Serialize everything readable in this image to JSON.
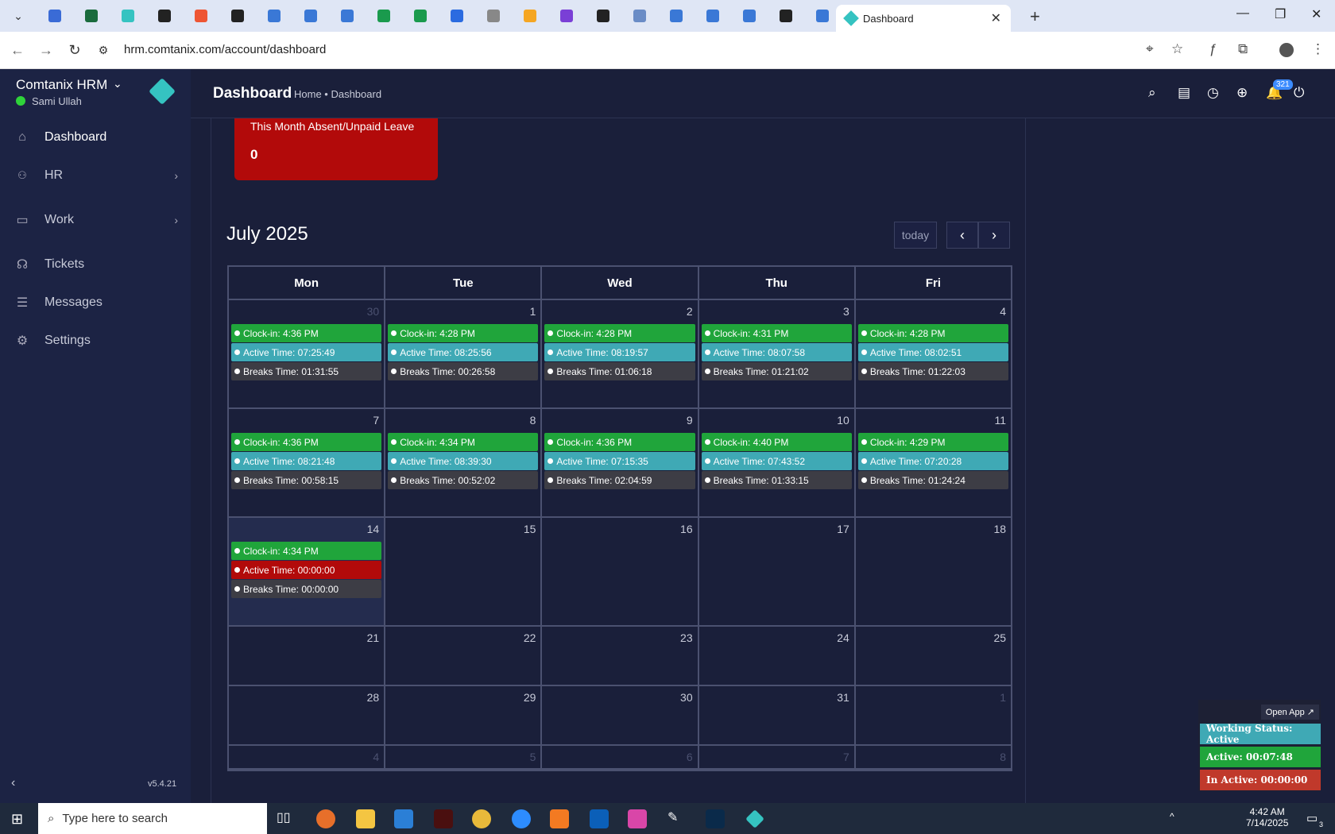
{
  "browser": {
    "active_tab_title": "Dashboard",
    "url": "hrm.comtanix.com/account/dashboard",
    "tab_icon_colors": [
      "#3a6bd6",
      "#1a6b3d",
      "#35c3c1",
      "#222",
      "#e53",
      "#222",
      "#3a78d6",
      "#3a78d6",
      "#3a78d6",
      "#1a9a4d",
      "#1a9a4d",
      "#2b6be0",
      "#888",
      "#f5a623",
      "#7a3fd6",
      "#222",
      "#6a8cc6",
      "#3a78d6",
      "#3a78d6",
      "#3a78d6",
      "#222",
      "#3a78d6"
    ]
  },
  "sidebar": {
    "brand": "Comtanix HRM",
    "user": "Sami Ullah",
    "items": [
      {
        "label": "Dashboard",
        "icon": "home-icon",
        "glyph": "⌂"
      },
      {
        "label": "HR",
        "icon": "users-icon",
        "glyph": "👥"
      },
      {
        "label": "Work",
        "icon": "briefcase-icon",
        "glyph": "▭"
      },
      {
        "label": "Tickets",
        "icon": "headset-icon",
        "glyph": "☊"
      },
      {
        "label": "Messages",
        "icon": "message-icon",
        "glyph": "☰"
      },
      {
        "label": "Settings",
        "icon": "gear-icon",
        "glyph": "⚙"
      }
    ],
    "version": "v5.4.21"
  },
  "header": {
    "title": "Dashboard",
    "breadcrumb": "Home • Dashboard",
    "notification_count": "321"
  },
  "absent_card": {
    "title": "This Month Absent/Unpaid Leave",
    "value": "0"
  },
  "calendar": {
    "month": "July 2025",
    "today_label": "today",
    "weekdays": [
      "Mon",
      "Tue",
      "Wed",
      "Thu",
      "Fri"
    ],
    "weeks": [
      [
        {
          "day": "30",
          "muted": true,
          "events": [
            "Clock-in: 4:36 PM",
            "Active Time: 07:25:49",
            "Breaks Time: 01:31:55"
          ]
        },
        {
          "day": "1",
          "events": [
            "Clock-in: 4:28 PM",
            "Active Time: 08:25:56",
            "Breaks Time: 00:26:58"
          ]
        },
        {
          "day": "2",
          "events": [
            "Clock-in: 4:28 PM",
            "Active Time: 08:19:57",
            "Breaks Time: 01:06:18"
          ]
        },
        {
          "day": "3",
          "events": [
            "Clock-in: 4:31 PM",
            "Active Time: 08:07:58",
            "Breaks Time: 01:21:02"
          ]
        },
        {
          "day": "4",
          "events": [
            "Clock-in: 4:28 PM",
            "Active Time: 08:02:51",
            "Breaks Time: 01:22:03"
          ]
        }
      ],
      [
        {
          "day": "7",
          "events": [
            "Clock-in: 4:36 PM",
            "Active Time: 08:21:48",
            "Breaks Time: 00:58:15"
          ]
        },
        {
          "day": "8",
          "events": [
            "Clock-in: 4:34 PM",
            "Active Time: 08:39:30",
            "Breaks Time: 00:52:02"
          ]
        },
        {
          "day": "9",
          "events": [
            "Clock-in: 4:36 PM",
            "Active Time: 07:15:35",
            "Breaks Time: 02:04:59"
          ]
        },
        {
          "day": "10",
          "events": [
            "Clock-in: 4:40 PM",
            "Active Time: 07:43:52",
            "Breaks Time: 01:33:15"
          ]
        },
        {
          "day": "11",
          "events": [
            "Clock-in: 4:29 PM",
            "Active Time: 07:20:28",
            "Breaks Time: 01:24:24"
          ]
        }
      ],
      [
        {
          "day": "14",
          "today": true,
          "active_red": true,
          "events": [
            "Clock-in: 4:34 PM",
            "Active Time: 00:00:00",
            "Breaks Time: 00:00:00"
          ]
        },
        {
          "day": "15",
          "events": []
        },
        {
          "day": "16",
          "events": []
        },
        {
          "day": "17",
          "events": []
        },
        {
          "day": "18",
          "events": []
        }
      ],
      [
        {
          "day": "21",
          "events": []
        },
        {
          "day": "22",
          "events": []
        },
        {
          "day": "23",
          "events": []
        },
        {
          "day": "24",
          "events": []
        },
        {
          "day": "25",
          "events": []
        }
      ],
      [
        {
          "day": "28",
          "events": []
        },
        {
          "day": "29",
          "events": []
        },
        {
          "day": "30",
          "events": []
        },
        {
          "day": "31",
          "events": []
        },
        {
          "day": "1",
          "muted": true,
          "events": []
        }
      ],
      [
        {
          "day": "4",
          "muted": true,
          "events": []
        },
        {
          "day": "5",
          "muted": true,
          "events": []
        },
        {
          "day": "6",
          "muted": true,
          "events": []
        },
        {
          "day": "7",
          "muted": true,
          "events": []
        },
        {
          "day": "8",
          "muted": true,
          "events": []
        }
      ]
    ]
  },
  "widget": {
    "open_app": "Open App ↗",
    "working_status": "Working Status: Active",
    "active": "Active: 00:07:48",
    "inactive": "In Active: 00:00:00"
  },
  "taskbar": {
    "search_placeholder": "Type here to search",
    "time": "4:42 AM",
    "date": "7/14/2025",
    "notification_count": "3"
  },
  "colors": {
    "clock_in": "#20a53b",
    "active_time": "#3fa9b5",
    "breaks_time": "#3d3d45",
    "alert": "#b20a0a"
  }
}
